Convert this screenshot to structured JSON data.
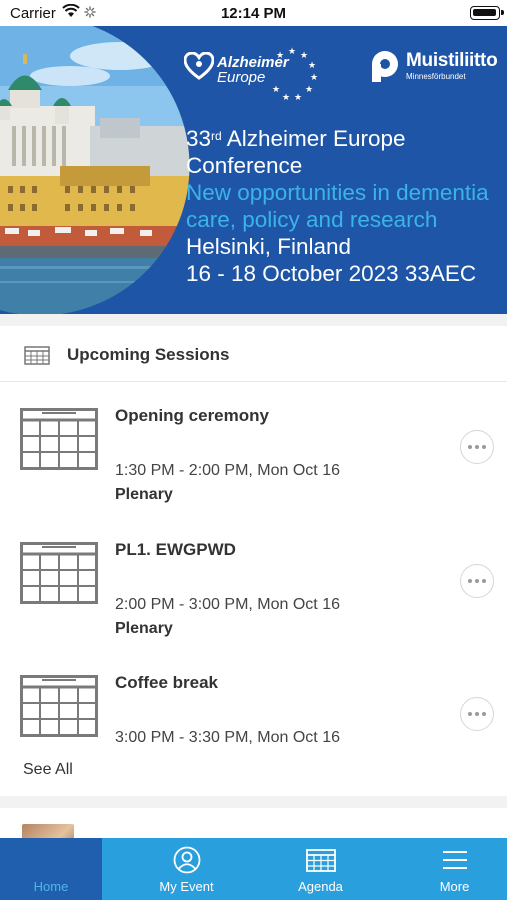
{
  "status": {
    "carrier": "Carrier",
    "time": "12:14 PM"
  },
  "banner": {
    "logo_left_line1": "Alzheimer",
    "logo_left_line2": "Europe",
    "logo_right_title": "Muistiliitto",
    "logo_right_sub": "Minnesförbundet",
    "line1_num": "33",
    "line1_sup": "rd",
    "line1_rest": " Alzheimer Europe",
    "line2": "Conference",
    "line3": "New opportunities in dementia",
    "line4": "care, policy and research",
    "line5": "Helsinki, Finland",
    "line6": "16 - 18 October 2023 33AEC",
    "accent": "#3ab4e8",
    "bg": "#1f55a6"
  },
  "sessions": {
    "header": "Upcoming Sessions",
    "items": [
      {
        "title": "Opening ceremony",
        "time": "1:30 PM - 2:00 PM, Mon Oct 16",
        "track": "Plenary"
      },
      {
        "title": "PL1. EWGPWD",
        "time": "2:00 PM - 3:00 PM, Mon Oct 16",
        "track": "Plenary"
      },
      {
        "title": "Coffee break",
        "time": "3:00 PM - 3:30 PM, Mon Oct 16",
        "track": ""
      }
    ],
    "see_all": "See All"
  },
  "tabbar": {
    "tabs": [
      {
        "label": "Home",
        "icon": "home-icon",
        "active": true
      },
      {
        "label": "My Event",
        "icon": "user-icon",
        "active": false
      },
      {
        "label": "Agenda",
        "icon": "calendar-icon",
        "active": false
      },
      {
        "label": "More",
        "icon": "menu-icon",
        "active": false
      }
    ],
    "bg": "#2a9fdd",
    "active_bg": "#1f5fae"
  }
}
